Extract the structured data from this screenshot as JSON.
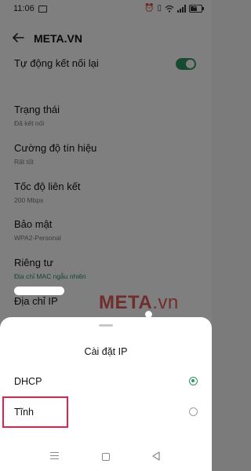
{
  "status_bar": {
    "time": "11:06",
    "battery": "53",
    "icons": [
      "alarm-icon",
      "vibrate-icon",
      "wifi-icon",
      "signal-icon",
      "battery-icon"
    ]
  },
  "header": {
    "title": "META.VN"
  },
  "settings": {
    "auto_reconnect": {
      "label": "Tự động kết nối lại",
      "enabled": true
    },
    "status": {
      "label": "Trạng thái",
      "value": "Đã kết nối"
    },
    "signal_strength": {
      "label": "Cường độ tín hiệu",
      "value": "Rất tốt"
    },
    "link_speed": {
      "label": "Tốc độ liên kết",
      "value": "200 Mbps"
    },
    "security": {
      "label": "Bảo mật",
      "value": "WPA2-Personal"
    },
    "privacy": {
      "label": "Riêng tư",
      "value": "Địa chỉ MAC ngẫu nhiên"
    },
    "ip_address": {
      "label": "Địa chỉ IP"
    }
  },
  "watermark": {
    "meta": "META",
    "vn": ".vn"
  },
  "ip_sheet": {
    "title": "Cài đặt IP",
    "options": [
      {
        "label": "DHCP",
        "selected": true
      },
      {
        "label": "Tĩnh",
        "selected": false
      }
    ]
  },
  "colors": {
    "accent": "#2f9460",
    "highlight": "#e0224e",
    "watermark": "#e35b5b"
  }
}
